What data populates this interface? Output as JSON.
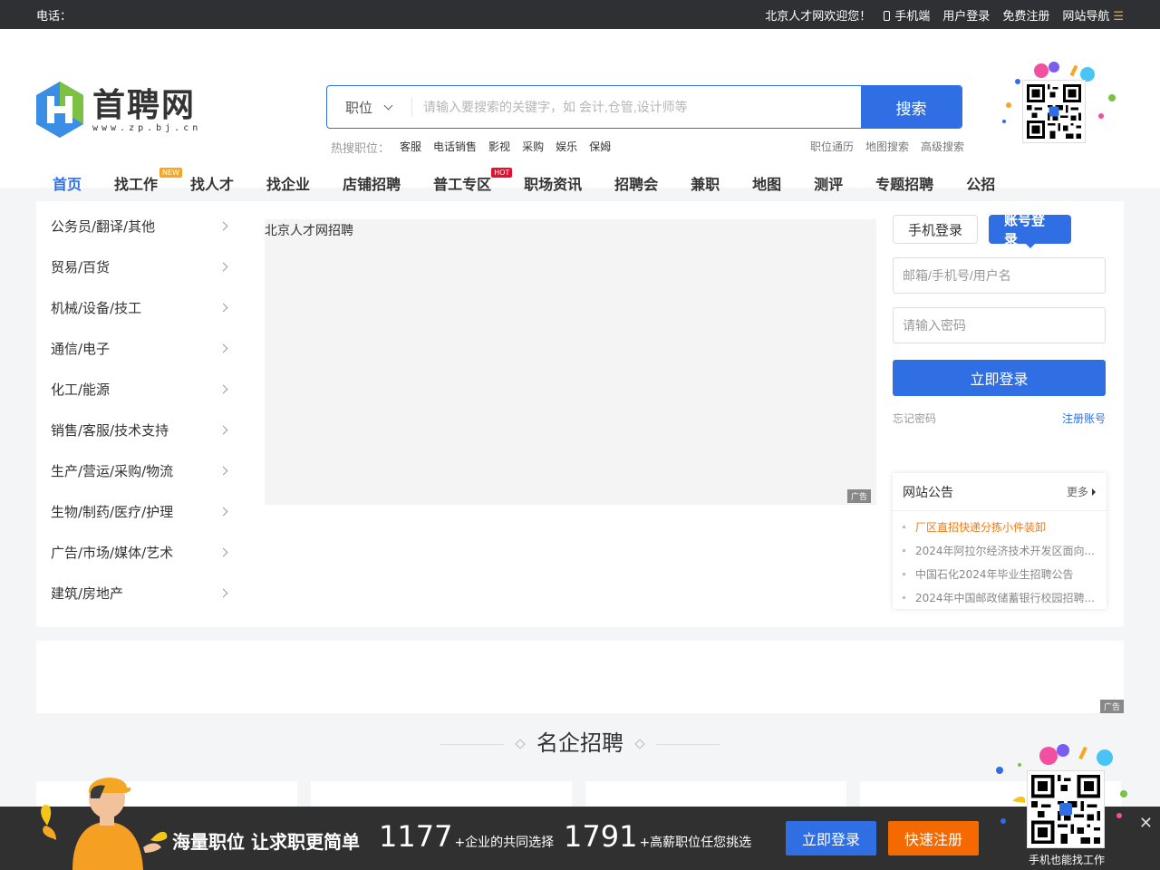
{
  "topbar": {
    "phone_label": "电话：",
    "welcome": "北京人才网欢迎您！",
    "mobile": "手机端",
    "login": "用户登录",
    "register": "免费注册",
    "sitenav": "网站导航",
    "sitenav_icon": "menu-icon"
  },
  "logo": {
    "cn": "首聘网",
    "en": "www.zp.bj.cn"
  },
  "search": {
    "type": "职位",
    "placeholder": "请输入要搜索的关键字，如 会计,仓管,设计师等",
    "button": "搜索",
    "hot_label": "热搜职位：",
    "hot": [
      "客服",
      "电话销售",
      "影视",
      "采购",
      "娱乐",
      "保姆"
    ],
    "links": [
      "职位通历",
      "地图搜索",
      "高级搜索"
    ]
  },
  "nav": {
    "items": [
      "首页",
      "找工作",
      "找人才",
      "找企业",
      "店铺招聘",
      "普工专区",
      "职场资讯",
      "招聘会",
      "兼职",
      "地图",
      "测评",
      "专题招聘",
      "公招"
    ],
    "badge_new": "NEW",
    "badge_hot": "HOT",
    "accent": "#2f6fe3"
  },
  "categories": [
    "公务员/翻译/其他",
    "贸易/百货",
    "机械/设备/技工",
    "通信/电子",
    "化工/能源",
    "销售/客服/技术支持",
    "生产/营运/采购/物流",
    "生物/制药/医疗/护理",
    "广告/市场/媒体/艺术",
    "建筑/房地产"
  ],
  "banner": {
    "alt": "北京人才网招聘",
    "ad": "广告"
  },
  "login": {
    "tab_phone": "手机登录",
    "tab_account": "账号登录",
    "user_placeholder": "邮箱/手机号/用户名",
    "pass_placeholder": "请输入密码",
    "submit": "立即登录",
    "forgot": "忘记密码",
    "register": "注册账号"
  },
  "notice": {
    "title": "网站公告",
    "more": "更多",
    "items": [
      "厂区直招快递分拣小件装卸",
      "2024年阿拉尔经济技术开发区面向...",
      "中国石化2024年毕业生招聘公告",
      "2024年中国邮政储蓄银行校园招聘..."
    ]
  },
  "adstrip": {
    "ad": "广告"
  },
  "section": {
    "title": "名企招聘"
  },
  "bottombar": {
    "slogan": "海量职位 让求职更简单",
    "companies_num": "1177",
    "companies_desc": "+企业的共同选择",
    "jobs_num": "1791",
    "jobs_desc": "+高薪职位任您挑选",
    "login": "立即登录",
    "register": "快速注册",
    "qr_caption": "手机也能找工作",
    "close_icon": "close-icon"
  }
}
